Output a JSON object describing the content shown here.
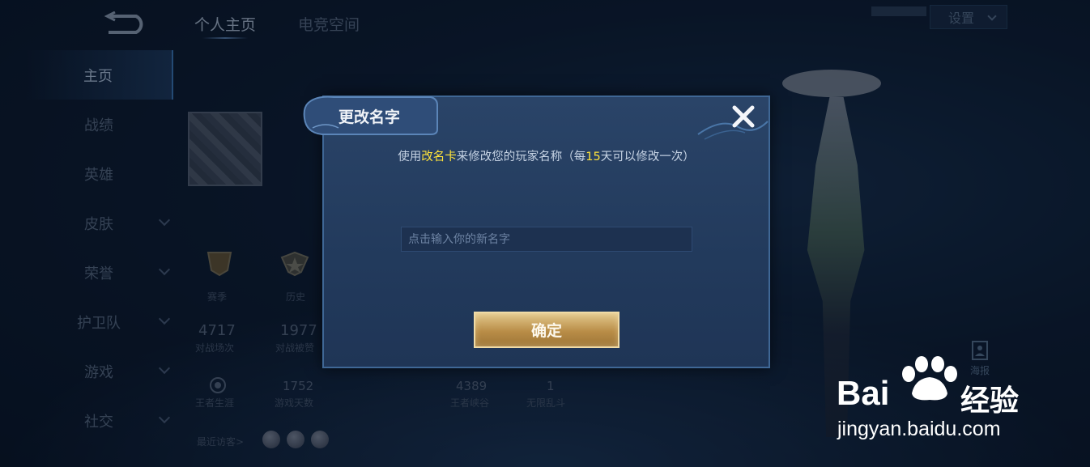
{
  "nav": {
    "top_tabs": [
      "个人主页",
      "电竞空间"
    ],
    "sidebar": [
      "主页",
      "战绩",
      "英雄",
      "皮肤",
      "荣誉",
      "护卫队",
      "游戏",
      "社交"
    ],
    "settings_label": "设置"
  },
  "profile": {
    "medals": [
      "赛季",
      "历史"
    ],
    "stats_row1": [
      {
        "value": "4717",
        "label": "对战场次"
      },
      {
        "value": "1977",
        "label": "对战被赞"
      }
    ],
    "stats_row2": [
      {
        "value": "",
        "label": "王者生涯"
      },
      {
        "value": "1752",
        "label": "游戏天数"
      },
      {
        "value": "4389",
        "label": "王者峡谷"
      },
      {
        "value": "1",
        "label": "无限乱斗"
      }
    ],
    "recent_visitors_label": "最近访客>",
    "poster_label": "海报"
  },
  "dialog": {
    "title": "更改名字",
    "desc_before": "使用",
    "desc_item": "改名卡",
    "desc_middle": "来修改您的玩家名称（每",
    "desc_days": "15",
    "desc_after": "天可以修改一次）",
    "input_placeholder": "点击输入你的新名字",
    "input_value": "",
    "confirm_label": "确定"
  },
  "watermark": {
    "logo_text": "Bai du 经验",
    "url": "jingyan.baidu.com"
  },
  "colors": {
    "highlight": "#ffe33b",
    "dialog_bg": "#2a4468",
    "confirm_gold": "#b98d47"
  }
}
